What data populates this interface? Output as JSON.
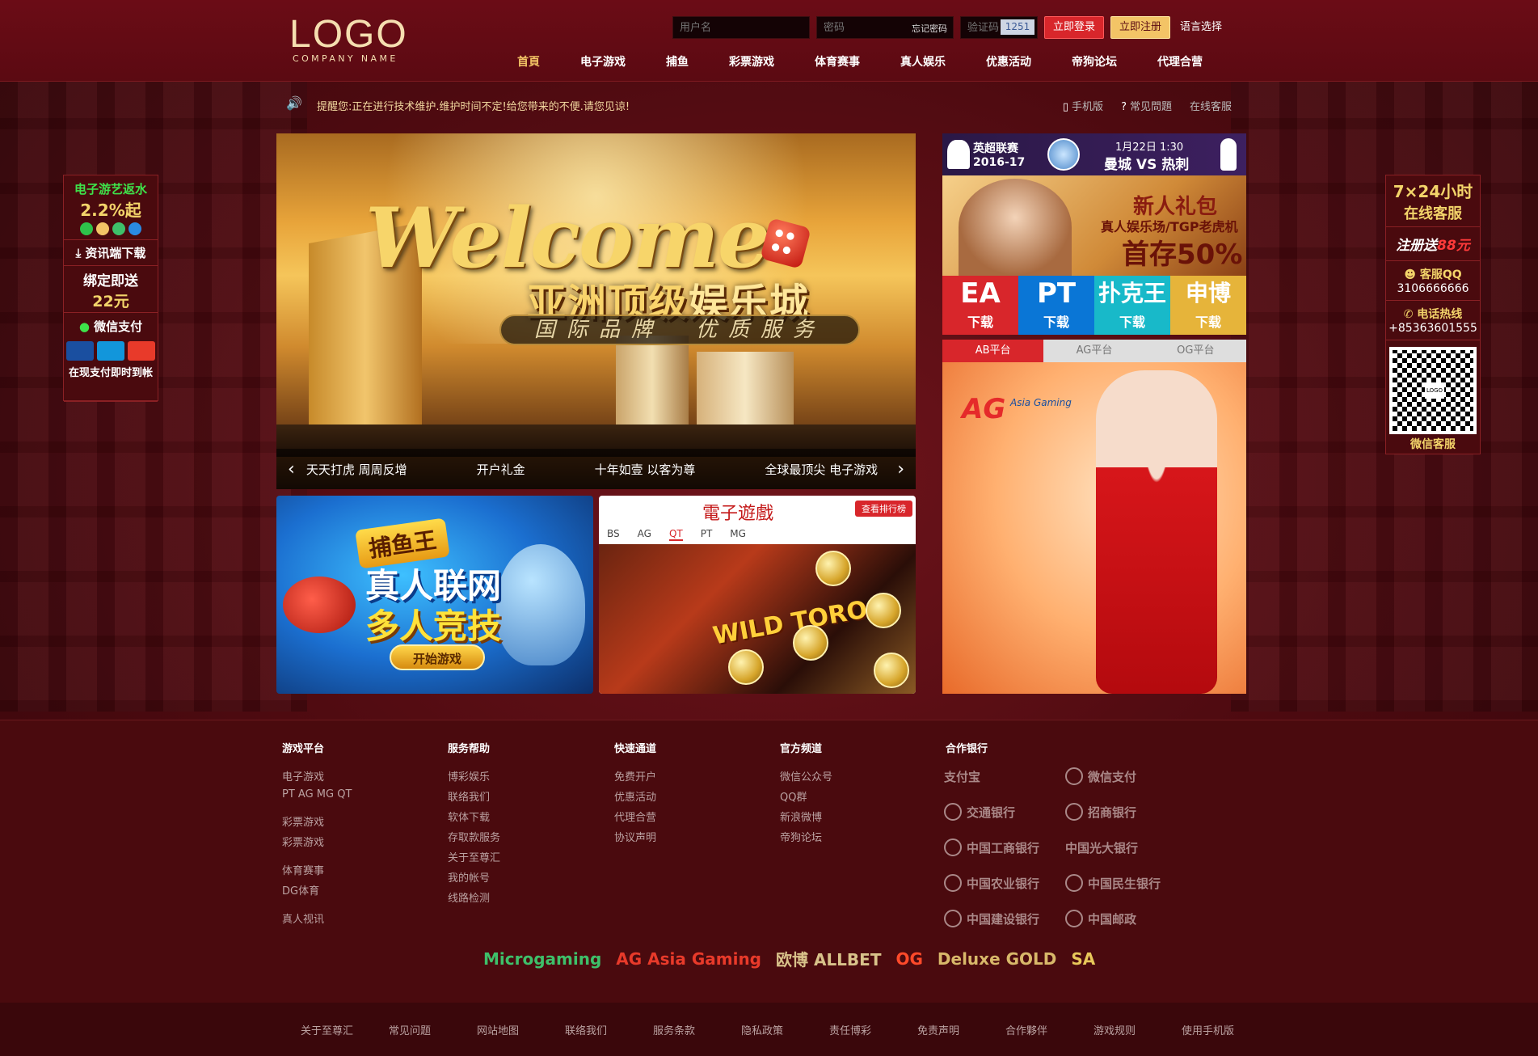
{
  "brand": {
    "logo": "LOGO",
    "company": "COMPANY NAME"
  },
  "login": {
    "username_placeholder": "用户名",
    "password_placeholder": "密码",
    "forgot": "忘记密码",
    "captcha_placeholder": "验证码",
    "captcha_code": "1251",
    "login_button": "立即登录",
    "register_button": "立即注册",
    "language": "语言选择"
  },
  "nav": {
    "items": [
      {
        "label": "首頁",
        "active": true
      },
      {
        "label": "电子游戏"
      },
      {
        "label": "捕鱼"
      },
      {
        "label": "彩票游戏"
      },
      {
        "label": "体育赛事"
      },
      {
        "label": "真人娱乐"
      },
      {
        "label": "优惠活动"
      },
      {
        "label": "帝狗论坛"
      },
      {
        "label": "代理合营"
      }
    ]
  },
  "notice": {
    "text": "提醒您:正在进行技术维护.维护时间不定!给您带来的不便.请您见谅!",
    "mobile": "手机版",
    "faq": "常见問題",
    "service": "在线客服"
  },
  "banner": {
    "headline": "Welcome",
    "tagline_a": "亚洲顶级",
    "tagline_b": "娱乐城",
    "slogan": "国际品牌　优质服务",
    "captions": [
      "天天打虎 周周反增",
      "开户礼金",
      "十年如壹 以客为尊",
      "全球最顶尖 电子游戏"
    ]
  },
  "fish_card": {
    "badge": "捕鱼王",
    "line1": "真人联网",
    "line2": "多人竞技",
    "play": "开始游戏"
  },
  "slots_card": {
    "title": "電子遊戲",
    "ranking": "查看排行榜",
    "tabs": [
      "BS",
      "AG",
      "QT",
      "PT",
      "MG"
    ],
    "active_tab": "QT",
    "game": "WILD TORO"
  },
  "match": {
    "league": "英超联赛",
    "season": "2016-17",
    "date": "1月22日 1:30",
    "teams": "曼城 VS 热刺"
  },
  "promo": {
    "title": "新人礼包",
    "sub": "真人娱乐场/TGP老虎机",
    "deposit": "首存50%"
  },
  "downloads": [
    {
      "name": "EA",
      "label": "下载"
    },
    {
      "name": "PT",
      "label": "下载"
    },
    {
      "name": "扑克王",
      "label": "下载"
    },
    {
      "name": "申博",
      "label": "下载"
    }
  ],
  "platforms": {
    "tabs": [
      "AB平台",
      "AG平台",
      "OG平台"
    ],
    "active": "AB平台",
    "ag_brand": "AG",
    "ag_sub": "Asia Gaming"
  },
  "left_float": {
    "rebate_title": "电子游艺返水",
    "rebate_value": "2.2%起",
    "download": "资讯端下载",
    "bind_title": "绑定即送",
    "bind_value": "22元",
    "wechat": "微信支付",
    "instant": "在现支付即时到帐"
  },
  "right_float": {
    "hours": "7×24小时",
    "online": "在线客服",
    "register_gift_a": "注册送",
    "register_gift_b": "88元",
    "qq_label": "客服QQ",
    "qq": "3106666666",
    "hotline_label": "电话热线",
    "hotline": "+85363601555",
    "qr_logo": "LOGO",
    "wechat_service": "微信客服"
  },
  "footer": {
    "cols": [
      {
        "title": "游戏平台",
        "groups": [
          [
            "电子游戏",
            "PT AG MG QT"
          ],
          [
            "彩票游戏",
            "彩票游戏"
          ],
          [
            "体育赛事",
            "DG体育"
          ],
          [
            "真人视讯"
          ]
        ]
      },
      {
        "title": "服务帮助",
        "groups": [
          [
            "博彩娱乐",
            "联络我们",
            "软体下载",
            "存取款服务",
            "关于至尊汇",
            "我的帐号",
            "线路检测"
          ]
        ]
      },
      {
        "title": "快速通道",
        "groups": [
          [
            "免费开户",
            "优惠活动",
            "代理合营",
            "协议声明"
          ]
        ]
      },
      {
        "title": "官方频道",
        "groups": [
          [
            "微信公众号",
            "QQ群",
            "新浪微博",
            "帝狗论坛"
          ]
        ]
      }
    ],
    "banks_title": "合作银行",
    "banks": [
      "支付宝",
      "微信支付",
      "交通银行",
      "招商银行",
      "中国工商银行",
      "中国光大银行",
      "中国农业银行",
      "中国民生银行",
      "中国建设银行",
      "中国邮政"
    ],
    "partners": [
      "Microgaming",
      "AG Asia Gaming",
      "欧博 ALLBET",
      "OG",
      "Deluxe GOLD",
      "SA"
    ],
    "bottom_links": [
      "关于至尊汇",
      "常见问题",
      "网站地图",
      "联络我们",
      "服务条款",
      "隐私政策",
      "责任博彩",
      "免责声明",
      "合作夥伴",
      "游戏规则",
      "使用手机版"
    ]
  }
}
